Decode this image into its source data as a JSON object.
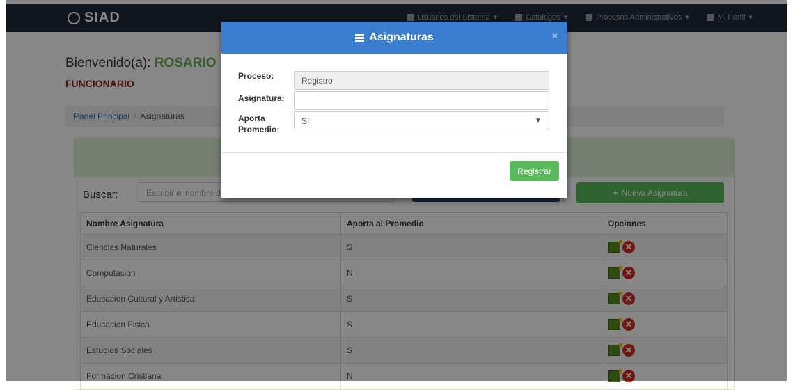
{
  "navbar": {
    "brand": "SIAD",
    "items": [
      {
        "label": "Usuarios del Sistema",
        "icon": "user-group-icon"
      },
      {
        "label": "Catalogos",
        "icon": "file-icon"
      },
      {
        "label": "Procesos Administrativos",
        "icon": "list-icon"
      },
      {
        "label": "Mi Perfil",
        "icon": "user-icon"
      }
    ]
  },
  "welcome": {
    "prefix": "Bienvenido(a):",
    "name": "ROSARIO"
  },
  "role": "FUNCIONARIO",
  "breadcrumb": {
    "home": "Panel Principal",
    "separator": "/",
    "current": "Asignaturas"
  },
  "search": {
    "label": "Buscar:",
    "placeholder": "Escribir el nombre de"
  },
  "new_button": "Nueva Asignatura",
  "table": {
    "headers": [
      "Nombre Asignatura",
      "Aporta al Promedio",
      "Opciones"
    ],
    "rows": [
      {
        "name": "Ciencias Naturales",
        "aporta": "S"
      },
      {
        "name": "Computacion",
        "aporta": "N"
      },
      {
        "name": "Educacion Cultural y Artistica",
        "aporta": "S"
      },
      {
        "name": "Educacion Fisica",
        "aporta": "S"
      },
      {
        "name": "Estudios Sociales",
        "aporta": "S"
      },
      {
        "name": "Formacion Cristiana",
        "aporta": "N"
      }
    ]
  },
  "modal": {
    "title": "Asignaturas",
    "close": "×",
    "proceso_label": "Proceso:",
    "proceso_value": "Registro",
    "asignatura_label": "Asignatura:",
    "asignatura_value": "",
    "aporta_label_1": "Aporta",
    "aporta_label_2": "Promedio:",
    "aporta_value": "SI",
    "submit": "Registrar"
  },
  "colors": {
    "navbar": "#202b3a",
    "modal_header": "#3a7fcf",
    "success": "#5cb85c",
    "role": "#8b1a1a",
    "welcome_name": "#6aa94e"
  }
}
